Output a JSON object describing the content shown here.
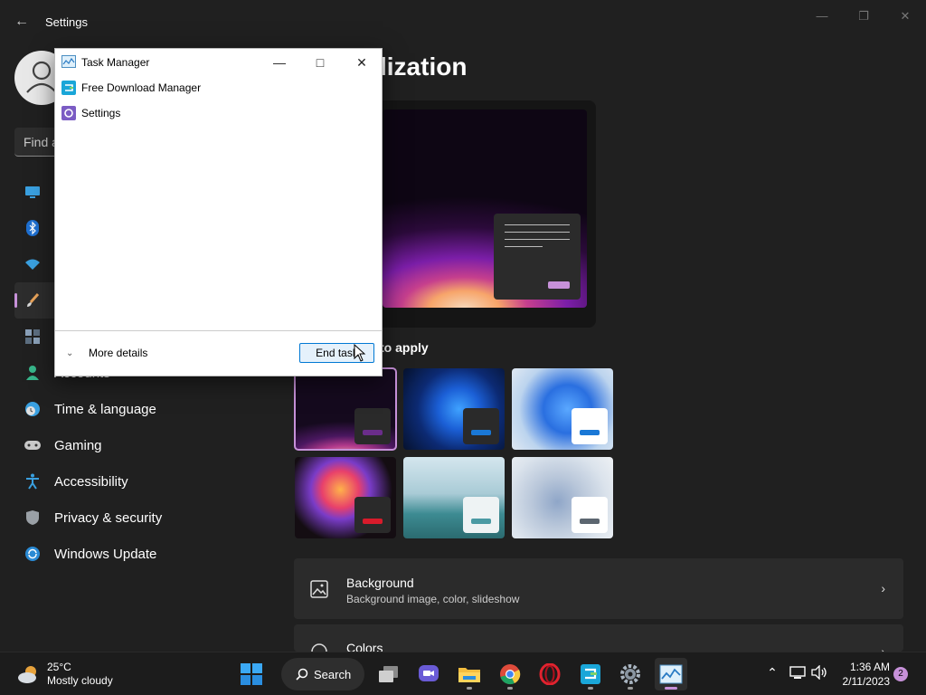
{
  "window": {
    "title": "Settings"
  },
  "sidebar": {
    "search_placeholder": "Find a",
    "items": [
      {
        "label": "",
        "icon": "monitor-icon"
      },
      {
        "label": "",
        "icon": "bluetooth-icon"
      },
      {
        "label": "",
        "icon": "wifi-icon"
      },
      {
        "label": "",
        "icon": "paintbrush-icon",
        "active": true
      },
      {
        "label": "",
        "icon": "apps-icon"
      },
      {
        "label": "Accounts",
        "icon": "person-icon"
      },
      {
        "label": "Time & language",
        "icon": "clock-globe-icon"
      },
      {
        "label": "Gaming",
        "icon": "gamepad-icon"
      },
      {
        "label": "Accessibility",
        "icon": "accessibility-icon"
      },
      {
        "label": "Privacy & security",
        "icon": "shield-icon"
      },
      {
        "label": "Windows Update",
        "icon": "update-icon"
      }
    ]
  },
  "main": {
    "title": "lization",
    "theme_label": "to apply",
    "cards": [
      {
        "title": "Background",
        "subtitle": "Background image, color, slideshow"
      },
      {
        "title": "Colors",
        "subtitle": ""
      }
    ]
  },
  "task_manager": {
    "title": "Task Manager",
    "apps": [
      "Free Download Manager",
      "Settings"
    ],
    "more_details": "More details",
    "end_task": "End task"
  },
  "taskbar": {
    "weather": {
      "temp": "25°C",
      "condition": "Mostly cloudy"
    },
    "search_label": "Search",
    "time": "1:36 AM",
    "date": "2/11/2023",
    "notification_count": "2"
  },
  "colors": {
    "accent": "#c791d9",
    "background": "#202020",
    "card": "#2b2b2b"
  }
}
